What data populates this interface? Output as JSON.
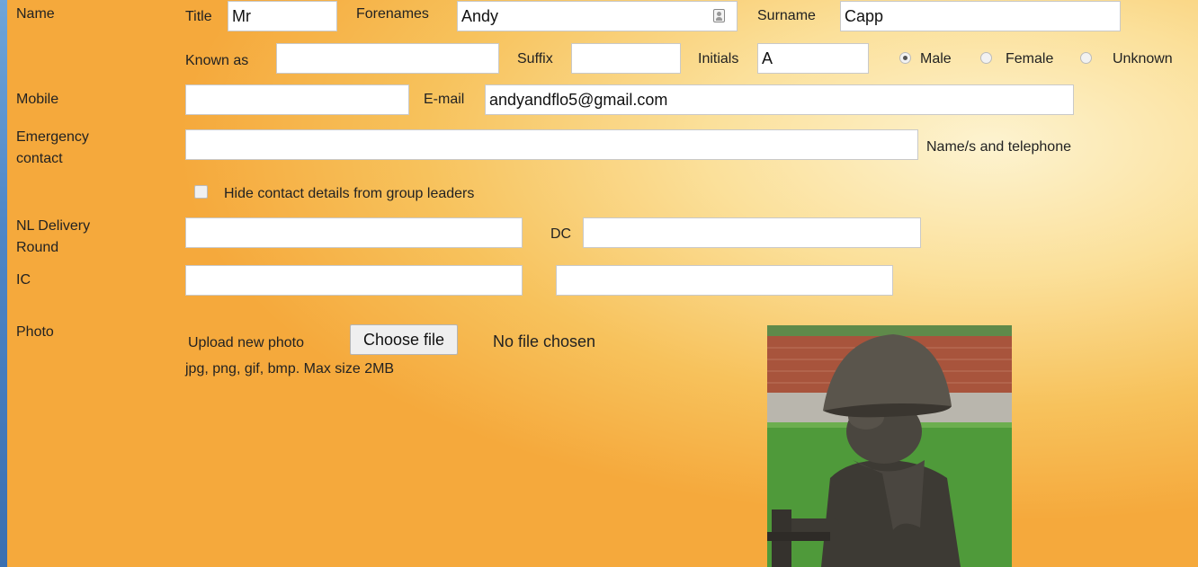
{
  "labels": {
    "name": "Name",
    "mobile": "Mobile",
    "emergency": "Emergency\ncontact",
    "nl_delivery": "NL Delivery\nRound",
    "ic": "IC",
    "photo": "Photo"
  },
  "name": {
    "title_label": "Title",
    "title_value": "Mr",
    "forenames_label": "Forenames",
    "forenames_value": "Andy",
    "surname_label": "Surname",
    "surname_value": "Capp",
    "known_as_label": "Known as",
    "known_as_value": "",
    "suffix_label": "Suffix",
    "suffix_value": "",
    "initials_label": "Initials",
    "initials_value": "A"
  },
  "gender": {
    "options": [
      "Male",
      "Female",
      "Unknown"
    ],
    "selected": "Male"
  },
  "contact": {
    "mobile_value": "",
    "email_label": "E-mail",
    "email_value": "andyandflo5@gmail.com",
    "emergency_value": "",
    "emergency_hint": "Name/s and telephone",
    "hide_label": "Hide contact details from group leaders",
    "hide_checked": false
  },
  "delivery": {
    "round_value": "",
    "dc_label": "DC",
    "dc_value": "",
    "ic_value": "",
    "ic_second_value": ""
  },
  "photo": {
    "upload_label": "Upload new photo",
    "choose_button": "Choose file",
    "no_file": "No file chosen",
    "formats": "jpg, png, gif, bmp. Max size 2MB"
  },
  "icons": {
    "contact_card": "contact-card-icon"
  }
}
